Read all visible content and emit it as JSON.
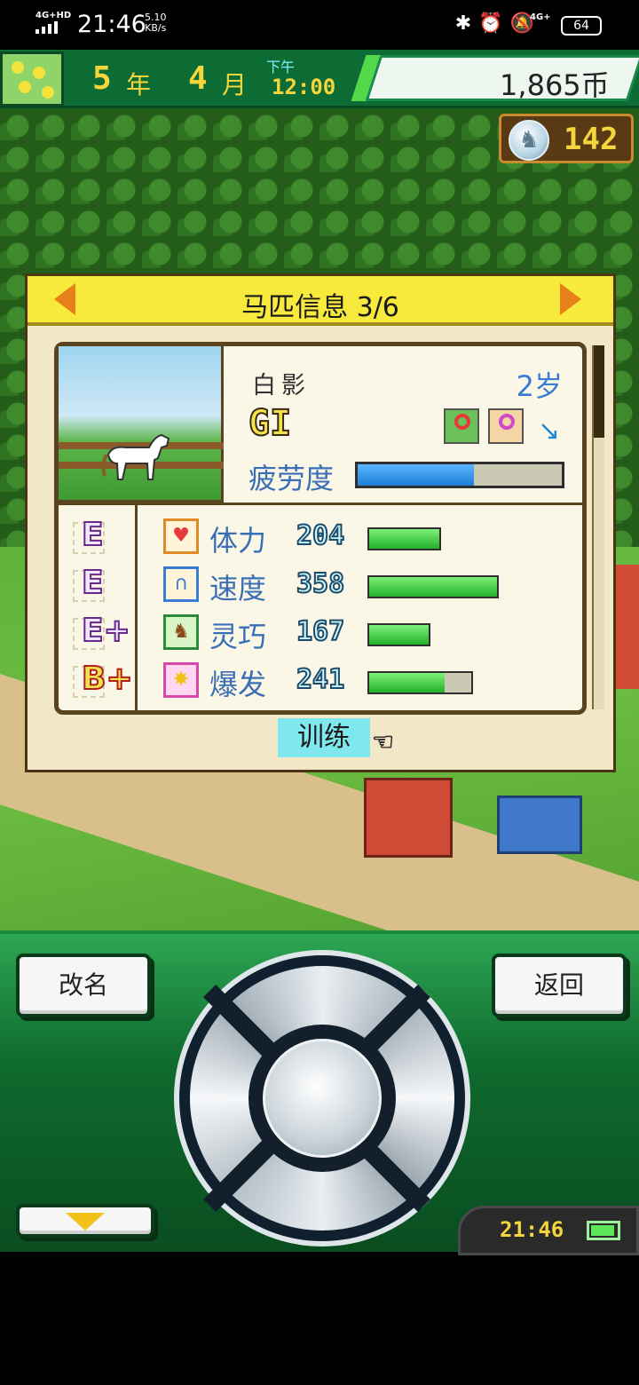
{
  "status_bar": {
    "network_label": "4G+HD",
    "time": "21:46",
    "speed_value": "5.10",
    "speed_unit": "KB/s",
    "icons": [
      "bluetooth-icon",
      "alarm-icon",
      "mute-icon"
    ],
    "network2_label": "4G+",
    "battery": "64"
  },
  "hud": {
    "year": "5",
    "year_unit": "年",
    "month": "4",
    "month_unit": "月",
    "ampm": "下午",
    "clock": "12:00",
    "money": "1,865币",
    "coins": "142"
  },
  "panel": {
    "title": "马匹信息 3/6",
    "horse_name": "白影",
    "horse_age": "2岁",
    "grade": "GI",
    "fatigue_label": "疲劳度",
    "fatigue_level": 0.57,
    "stats": [
      {
        "rank": "E",
        "name": "体力",
        "value": "204",
        "bar_fill": 1.0,
        "bar_width_ratio": 0.49,
        "icon": "heart-icon"
      },
      {
        "rank": "E",
        "name": "速度",
        "value": "358",
        "bar_fill": 1.0,
        "bar_width_ratio": 0.87,
        "icon": "horseshoe-icon"
      },
      {
        "rank": "E+",
        "name": "灵巧",
        "value": "167",
        "bar_fill": 1.0,
        "bar_width_ratio": 0.42,
        "icon": "horse-icon"
      },
      {
        "rank": "B+",
        "name": "爆发",
        "value": "241",
        "bar_fill": 0.74,
        "bar_width_ratio": 0.7,
        "icon": "burst-icon"
      }
    ],
    "train_label": "训练"
  },
  "controller": {
    "rename_label": "改名",
    "back_label": "返回",
    "mini_clock": "21:46"
  },
  "colors": {
    "hud_green": "#0d6b34",
    "header_yellow": "#f7ea3c",
    "fatigue_blue": "#1e7fd8",
    "stat_green": "#22b02a",
    "label_blue": "#3a6fb5"
  }
}
